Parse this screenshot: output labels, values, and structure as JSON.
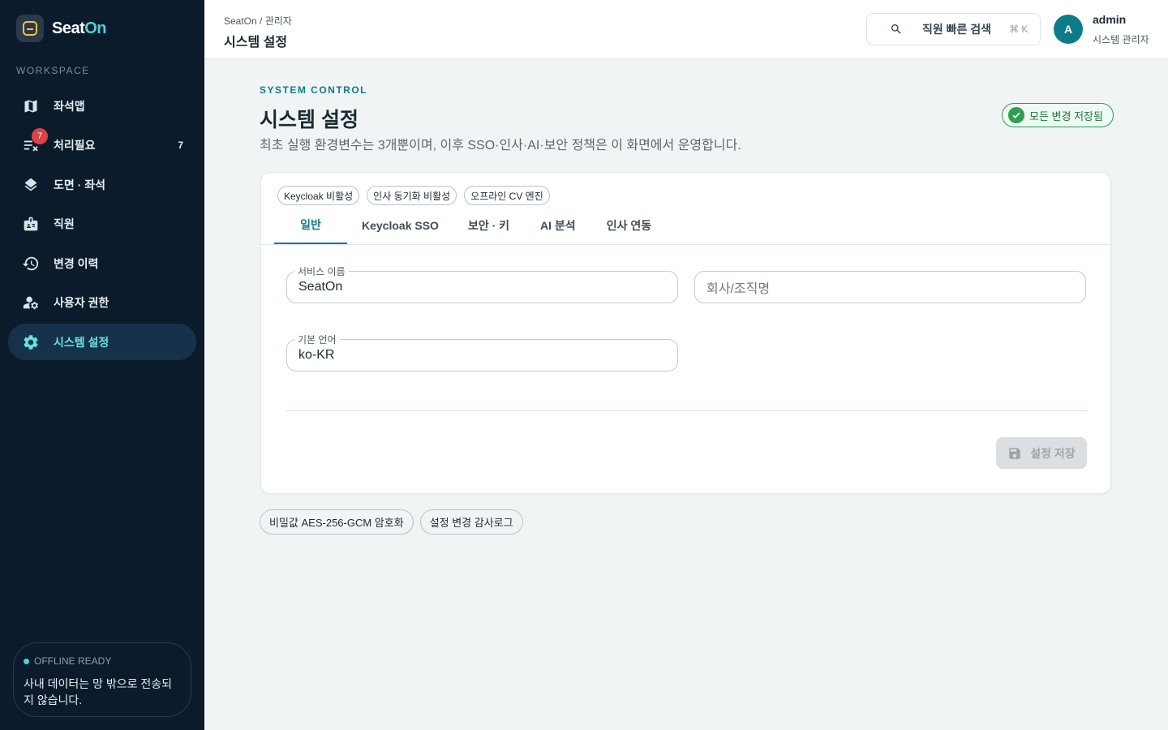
{
  "sidebar": {
    "brand_prefix": "Seat",
    "brand_highlight": "On",
    "section_label": "WORKSPACE",
    "items": [
      {
        "label": "좌석맵",
        "icon": "map-icon"
      },
      {
        "label": "처리필요",
        "icon": "task-list-icon",
        "badge": "7",
        "count": "7"
      },
      {
        "label": "도면 · 좌석",
        "icon": "layers-icon"
      },
      {
        "label": "직원",
        "icon": "id-badge-icon"
      },
      {
        "label": "변경 이력",
        "icon": "history-icon"
      },
      {
        "label": "사용자 권한",
        "icon": "user-settings-icon"
      },
      {
        "label": "시스템 설정",
        "icon": "gear-icon",
        "active": true
      }
    ],
    "offline": {
      "title": "OFFLINE READY",
      "text": "사내 데이터는 망 밖으로 전송되지 않습니다."
    }
  },
  "topbar": {
    "breadcrumb": "SeatOn / 관리자",
    "title": "시스템 설정",
    "search_label": "직원 빠른 검색",
    "search_shortcut": "⌘ K",
    "user": {
      "initial": "A",
      "name": "admin",
      "role": "시스템 관리자"
    }
  },
  "main": {
    "eyebrow": "SYSTEM CONTROL",
    "title": "시스템 설정",
    "description": "최초 실행 환경변수는 3개뿐이며, 이후 SSO·인사·AI·보안 정책은 이 화면에서 운영합니다.",
    "saved_status": "모든 변경 저장됨",
    "status_chips": [
      "Keycloak 비활성",
      "인사 동기화 비활성",
      "오프라인 CV 엔진"
    ],
    "tabs": [
      {
        "label": "일반",
        "active": true
      },
      {
        "label": "Keycloak SSO"
      },
      {
        "label": "보안 · 키"
      },
      {
        "label": "AI 분석"
      },
      {
        "label": "인사 연동"
      }
    ],
    "fields": {
      "service_name": {
        "label": "서비스 이름",
        "value": "SeatOn"
      },
      "company": {
        "placeholder": "회사/조직명"
      },
      "language": {
        "label": "기본 언어",
        "value": "ko-KR"
      }
    },
    "save_button": "설정 저장",
    "footer_chips": [
      "비밀값 AES-256-GCM 암호화",
      "설정 변경 감사로그"
    ]
  },
  "colors": {
    "sidebar_bg": "#0b1b2b",
    "accent": "#0e7c86",
    "accent_light": "#67e0e5",
    "badge_red": "#d9434a",
    "success": "#2e9e55"
  }
}
